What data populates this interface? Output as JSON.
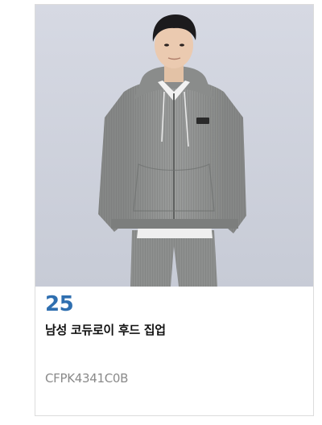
{
  "product": {
    "rank": "25",
    "name": "남성 코듀로이 후드 집업",
    "code": "CFPK4341C0B",
    "image_alt": "product-photo"
  },
  "colors": {
    "rank": "#2f6fb0",
    "background": "#cfd3dd",
    "hoodie": "#8f9190"
  }
}
